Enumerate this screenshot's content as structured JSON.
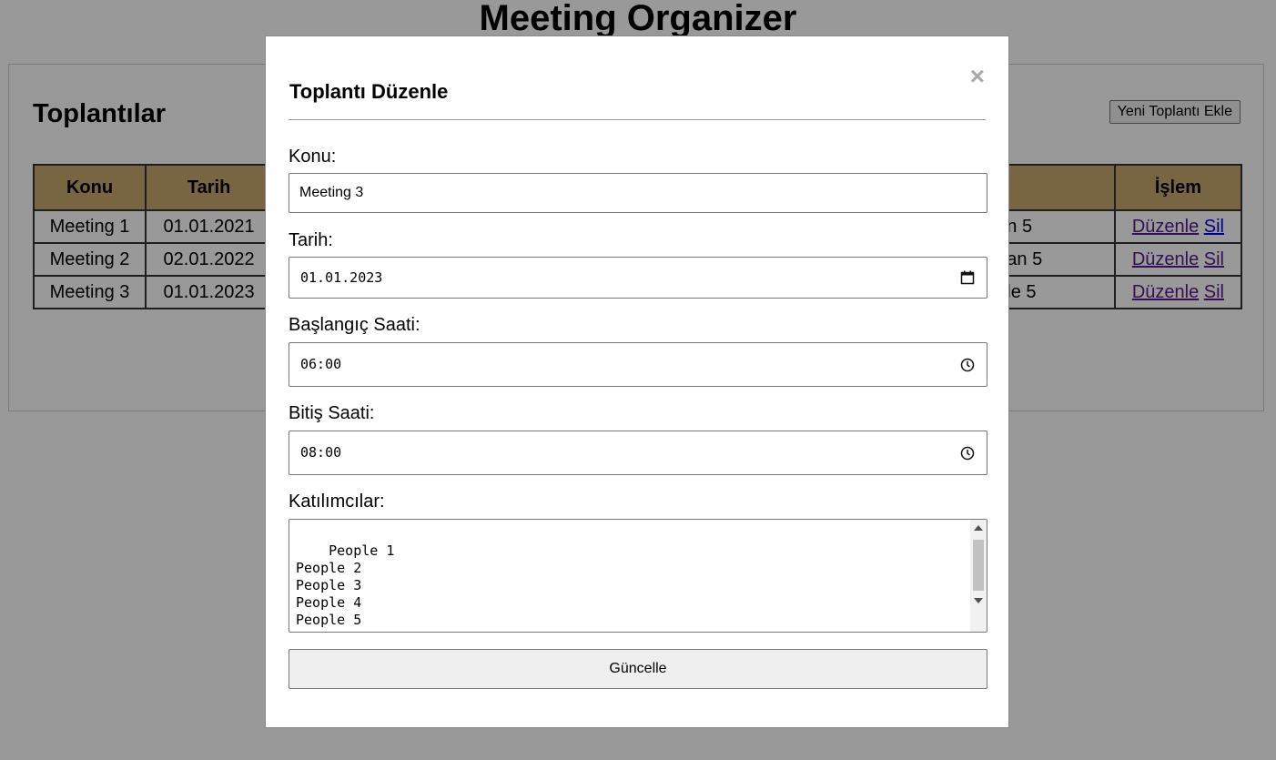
{
  "app": {
    "title": "Meeting Organizer"
  },
  "panel": {
    "heading": "Toplantılar",
    "add_button": "Yeni Toplantı Ekle",
    "table": {
      "headers": [
        "Konu",
        "Tarih",
        "İşlem"
      ],
      "rows": [
        {
          "konu": "Meeting 1",
          "tarih": "01.01.2021",
          "partial": "on 5",
          "edit": "Düzenle",
          "delete": "Sil"
        },
        {
          "konu": "Meeting 2",
          "tarih": "02.01.2022",
          "partial": "uan 5",
          "edit": "Düzenle",
          "delete": "Sil"
        },
        {
          "konu": "Meeting 3",
          "tarih": "01.01.2023",
          "partial": "ple 5",
          "edit": "Düzenle",
          "delete": "Sil"
        }
      ]
    }
  },
  "modal": {
    "title": "Toplantı Düzenle",
    "close_glyph": "×",
    "labels": {
      "konu": "Konu:",
      "tarih": "Tarih:",
      "baslangic": "Başlangıç Saati:",
      "bitis": "Bitiş Saati:",
      "katilimcilar": "Katılımcılar:"
    },
    "values": {
      "konu": "Meeting 3",
      "tarih": "01.01.2023",
      "baslangic": "06:00",
      "bitis": "08:00",
      "katilimcilar": "People 1\nPeople 2\nPeople 3\nPeople 4\nPeople 5"
    },
    "submit_label": "Güncelle"
  }
}
